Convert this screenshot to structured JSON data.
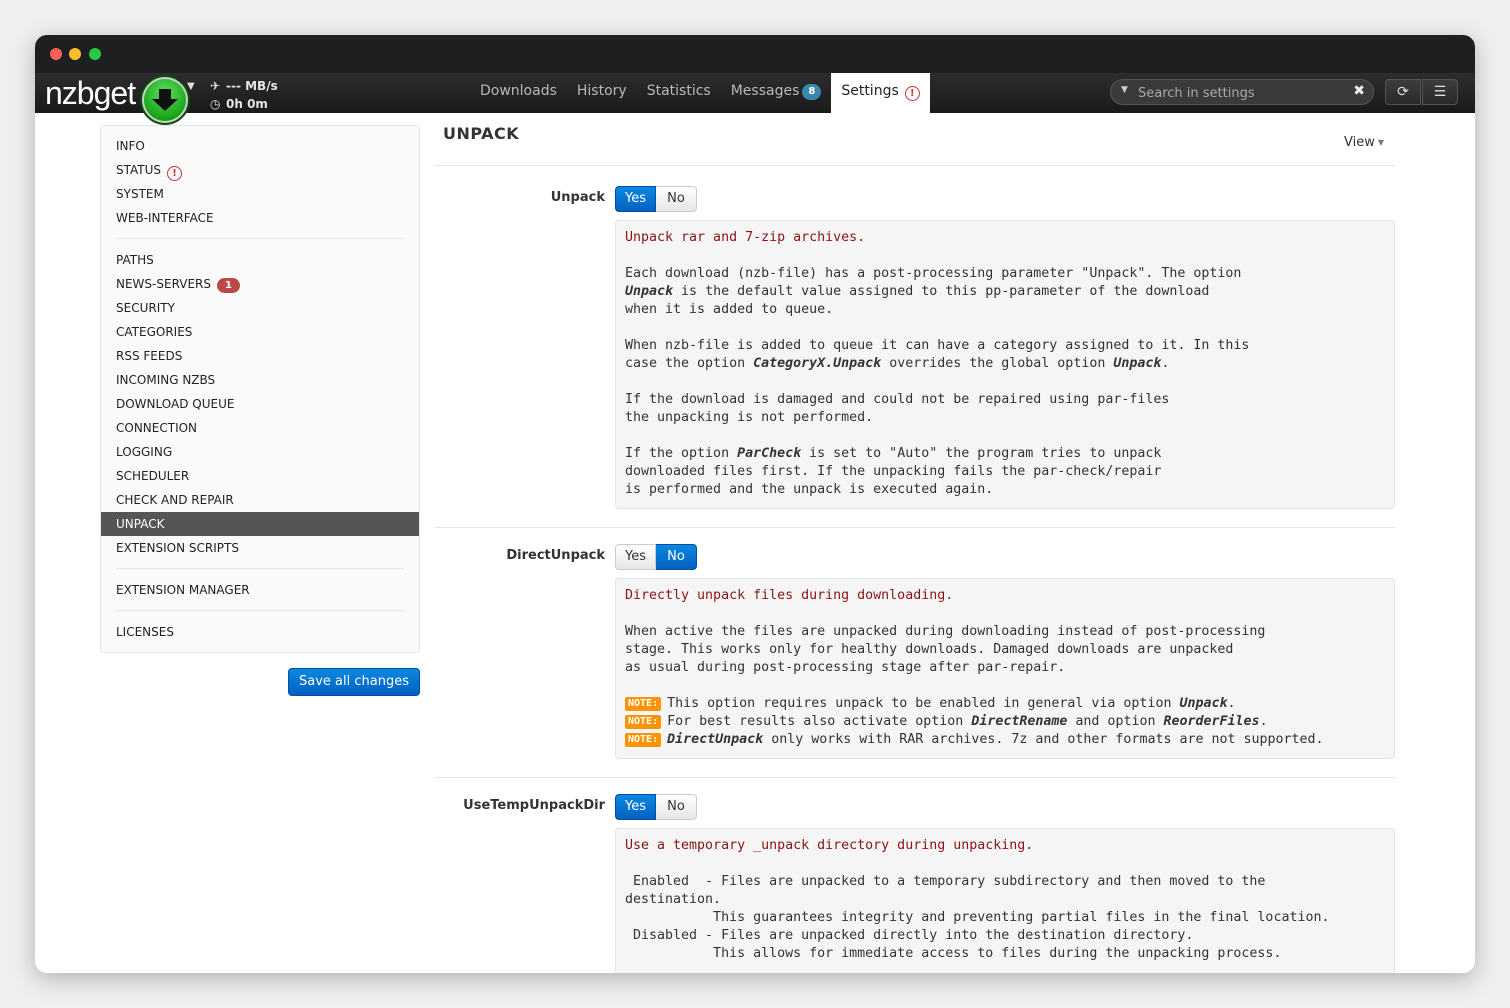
{
  "app": {
    "logo": "nzbget",
    "speed": "--- MB/s",
    "time": "0h 0m"
  },
  "nav": {
    "items": [
      {
        "label": "Downloads"
      },
      {
        "label": "History"
      },
      {
        "label": "Statistics"
      },
      {
        "label": "Messages",
        "badge": "8"
      },
      {
        "label": "Settings"
      }
    ]
  },
  "search": {
    "placeholder": "Search in settings"
  },
  "sidebar": {
    "items": [
      "INFO",
      "STATUS",
      "SYSTEM",
      "WEB-INTERFACE",
      "PATHS",
      "NEWS-SERVERS",
      "SECURITY",
      "CATEGORIES",
      "RSS FEEDS",
      "INCOMING NZBS",
      "DOWNLOAD QUEUE",
      "CONNECTION",
      "LOGGING",
      "SCHEDULER",
      "CHECK AND REPAIR",
      "UNPACK",
      "EXTENSION SCRIPTS",
      "EXTENSION MANAGER",
      "LICENSES"
    ],
    "news_badge": "1",
    "active": "UNPACK",
    "save_label": "Save all changes"
  },
  "page": {
    "title": "UNPACK",
    "view_label": "View"
  },
  "toggle": {
    "yes": "Yes",
    "no": "No"
  },
  "options": [
    {
      "name": "Unpack",
      "value": "Yes",
      "first_line": "Unpack rar and 7-zip archives."
    },
    {
      "name": "DirectUnpack",
      "value": "No",
      "first_line": "Directly unpack files during downloading."
    },
    {
      "name": "UseTempUnpackDir",
      "value": "Yes",
      "first_line": "Use a temporary _unpack directory during unpacking."
    }
  ],
  "notes": {
    "label": "NOTE:"
  },
  "colors": {
    "accent": "#0560c0",
    "active_sidebar": "#555555",
    "note": "#f89406",
    "desc_first": "#8b1414"
  }
}
